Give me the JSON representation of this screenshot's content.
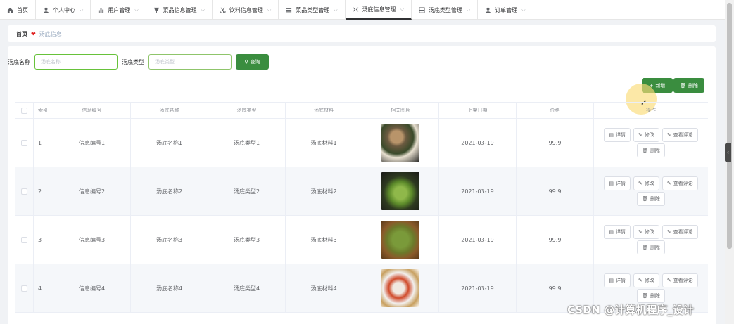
{
  "nav": {
    "items": [
      {
        "label": "首页",
        "icon": "home-icon",
        "has_chevron": false
      },
      {
        "label": "个人中心",
        "icon": "user-icon",
        "has_chevron": true
      },
      {
        "label": "用户管理",
        "icon": "chart-icon",
        "has_chevron": true
      },
      {
        "label": "菜品信息管理",
        "icon": "cup-icon",
        "has_chevron": true
      },
      {
        "label": "饮料信息管理",
        "icon": "scissors-icon",
        "has_chevron": true
      },
      {
        "label": "菜品类型管理",
        "icon": "menu-icon",
        "has_chevron": true
      },
      {
        "label": "汤底信息管理",
        "icon": "tool-icon",
        "has_chevron": true
      },
      {
        "label": "汤底类型管理",
        "icon": "grid-icon",
        "has_chevron": true
      },
      {
        "label": "订单管理",
        "icon": "user-icon",
        "has_chevron": true
      }
    ],
    "active_index": 6
  },
  "breadcrumb": {
    "home": "首页",
    "current": "汤底信息"
  },
  "search": {
    "name_label": "汤底名称",
    "name_placeholder": "汤底名称",
    "type_label": "汤底类型",
    "type_placeholder": "汤底类型",
    "search_button": "查询"
  },
  "actions": {
    "add": "新增",
    "delete": "删除"
  },
  "table": {
    "headers": [
      "索引",
      "信息编号",
      "汤底名称",
      "汤底类型",
      "汤底材料",
      "相关图片",
      "上架日期",
      "价格",
      "操作"
    ],
    "rows": [
      {
        "index": "1",
        "id": "信息编号1",
        "name": "汤底名称1",
        "type": "汤底类型1",
        "material": "汤底材料1",
        "date": "2021-03-19",
        "price": "99.9"
      },
      {
        "index": "2",
        "id": "信息编号2",
        "name": "汤底名称2",
        "type": "汤底类型2",
        "material": "汤底材料2",
        "date": "2021-03-19",
        "price": "99.9"
      },
      {
        "index": "3",
        "id": "信息编号3",
        "name": "汤底名称3",
        "type": "汤底类型3",
        "material": "汤底材料3",
        "date": "2021-03-19",
        "price": "99.9"
      },
      {
        "index": "4",
        "id": "信息编号4",
        "name": "汤底名称4",
        "type": "汤底类型4",
        "material": "汤底材料4",
        "date": "2021-03-19",
        "price": "99.9"
      }
    ],
    "row_ops": {
      "detail": "详情",
      "edit": "修改",
      "review": "查看评论",
      "delete": "删除"
    }
  },
  "watermark": "CSDN @计算机程序_设计",
  "colors": {
    "primary": "#3a8d3f",
    "input_border": "#67c23a",
    "heart": "#e02020"
  }
}
